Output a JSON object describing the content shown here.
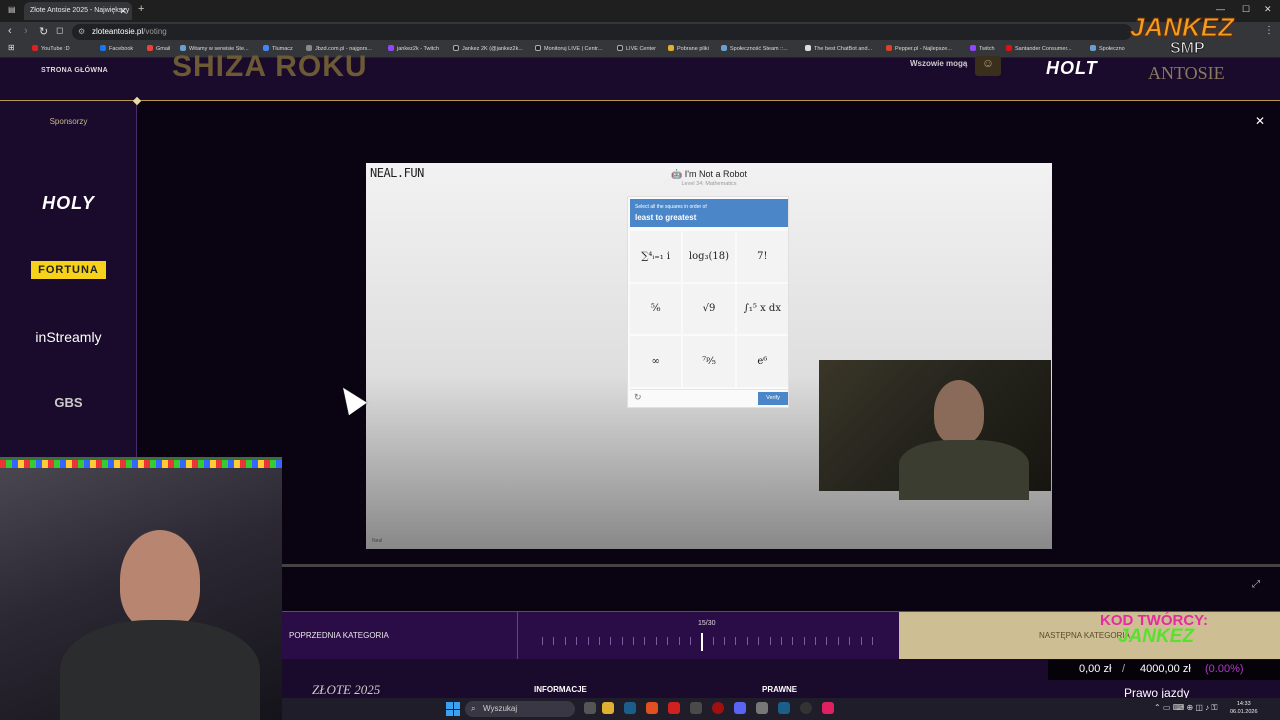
{
  "browser": {
    "tab_title": "Złote Antosie 2025 - Największy",
    "url_host": "zloteantosie.pl",
    "url_path": "/voting",
    "bookmarks": [
      "YouTube :D",
      "Facebook",
      "Gmail",
      "Witamy w serwisie Ste...",
      "Tłumacz",
      "Jbzd.com.pl - najgors...",
      "jankez2k - Twitch",
      "Jankez 2K (@jankez2k...",
      "Monitoruj LIVE | Centr...",
      "LIVE Center",
      "Pobrane pliki",
      "Społeczność Steam ::...",
      "The best ChatBot and...",
      "Pepper.pl - Najlepsze...",
      "Twitch",
      "Santander Consumer...",
      "Społeczno"
    ]
  },
  "header": {
    "home_link": "STRONA GŁÓWNA",
    "heading": "SHIZA ROKU",
    "right_text": "Wszowie mogą",
    "logo1": "HOLT",
    "logo2": "ANTOSIE"
  },
  "sidebar": {
    "title": "Sponsorzy",
    "sponsors": [
      "HOLY",
      "FORTUNA",
      "inStreamly",
      "GBS"
    ]
  },
  "neal": {
    "logo": "NEAL.FUN",
    "title": "I'm Not a Robot",
    "level": "Level 34: Mathematics",
    "instruction_small": "Select all the squares in order of",
    "instruction_big": "least to greatest",
    "cells": [
      "∑⁴ᵢ₌₁ i",
      "log₃(18)",
      "7!",
      "⁵⁄₆",
      "√9",
      "∫₁⁵ x dx",
      "∞",
      "⁷ᵖ⁄₅",
      "e⁶"
    ],
    "verify": "Verify",
    "bottom_label": "Neal"
  },
  "categories": {
    "prev": "POPRZEDNIA KATEGORIA",
    "next": "NASTĘPNA KATEGORIA",
    "progress": "15/30",
    "current": 15,
    "total": 30
  },
  "footer": {
    "logo": "ZŁOTE 2025",
    "info": "INFORMACJE",
    "legal": "PRAWNE"
  },
  "overlay": {
    "brand_top": "JANKEZ",
    "brand_sub": "SMP",
    "code_label": "KOD TWÓRCY:",
    "code_name": "JANKEZ",
    "donation_current": "0,00 zł",
    "donation_sep": "/",
    "donation_goal": "4000,00 zł",
    "donation_pct": "(0.00%)",
    "donation_label": "Prawo jazdy"
  },
  "taskbar": {
    "search": "Wyszukaj",
    "time": "14:33",
    "date": "06.01.2026"
  }
}
